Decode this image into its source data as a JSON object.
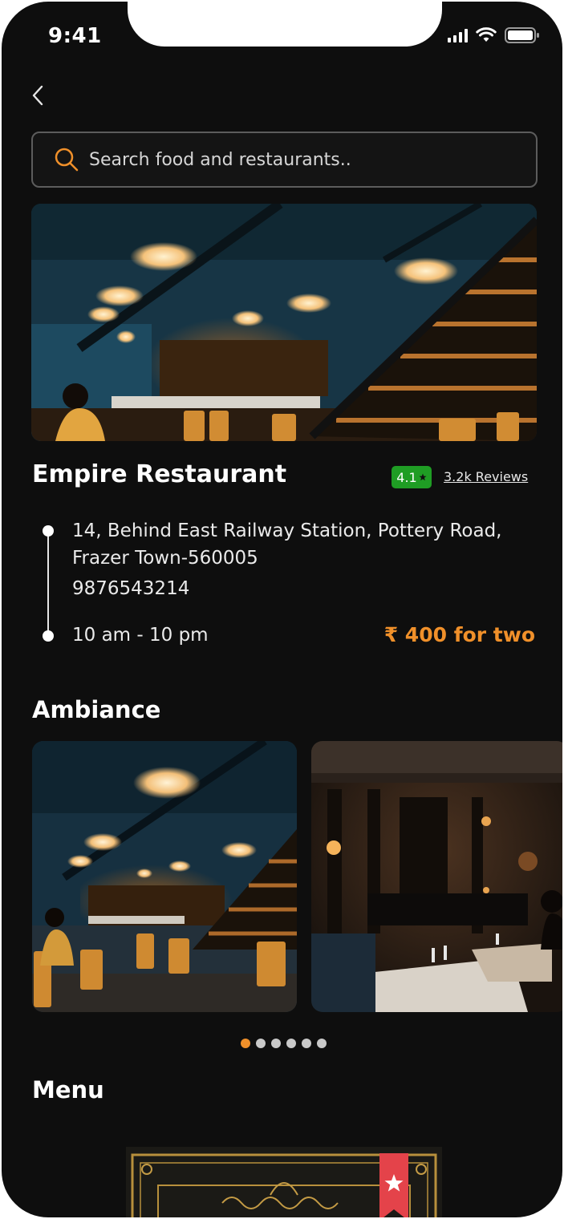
{
  "status_bar": {
    "time": "9:41"
  },
  "search": {
    "placeholder": "Search food and restaurants.."
  },
  "restaurant": {
    "name": "Empire Restaurant",
    "rating": "4.1",
    "reviews": "3.2k Reviews",
    "address_line1": "14, Behind East Railway Station, Pottery Road,",
    "address_line2": "Frazer Town-560005",
    "phone": "9876543214",
    "hours": "10 am - 10 pm",
    "price": "₹ 400 for two"
  },
  "sections": {
    "ambiance": "Ambiance",
    "menu": "Menu"
  },
  "carousel": {
    "total": 6,
    "active_index": 0
  },
  "colors": {
    "background": "#0e0e0e",
    "accent": "#f0902a",
    "rating_green": "#1f9d24"
  },
  "icons": [
    "back-chevron-icon",
    "search-icon",
    "cellular-signal-icon",
    "wifi-icon",
    "battery-icon",
    "star-icon",
    "bookmark-star-icon"
  ]
}
